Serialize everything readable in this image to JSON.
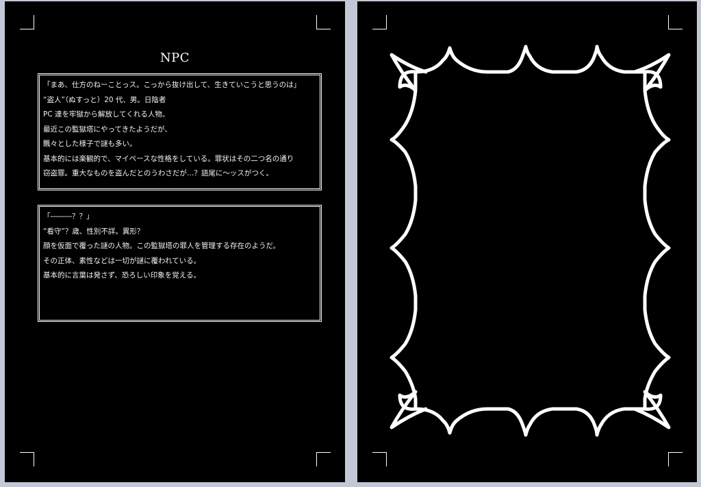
{
  "left_page": {
    "title": "NPC",
    "npcs": [
      {
        "lines": [
          "「まあ、仕方のねーことっス。こっから抜け出して、生きていこうと思うのは」",
          "“盗人”（ぬすっと）20 代、男。日陰者",
          "PC 達を牢獄から解放してくれる人物。",
          "最近この監獄塔にやってきたようだが、",
          "飄々とした様子で謎も多い。",
          "基本的には楽観的で、マイペースな性格をしている。罪状はその二つ名の通り",
          "窃盗罪。重大なものを盗んだとのうわさだが…？語尾に〜ッスがつく。"
        ]
      },
      {
        "lines": [
          "「―――？？」",
          "“看守”？歳、性別不詳。異形？",
          "顔を仮面で覆った謎の人物。この監獄塔の罪人を管理する存在のようだ。",
          "その正体、素性などは一切が謎に覆われている。",
          "基本的に言葉は発さず、恐ろしい印象を覚える。"
        ]
      }
    ]
  },
  "right_page": {
    "frame": "ornate-scalloped-border",
    "frame_color": "#ffffff"
  },
  "colors": {
    "workspace": "#c3c8d4",
    "page_background": "#000000",
    "text": "#ffffff"
  }
}
